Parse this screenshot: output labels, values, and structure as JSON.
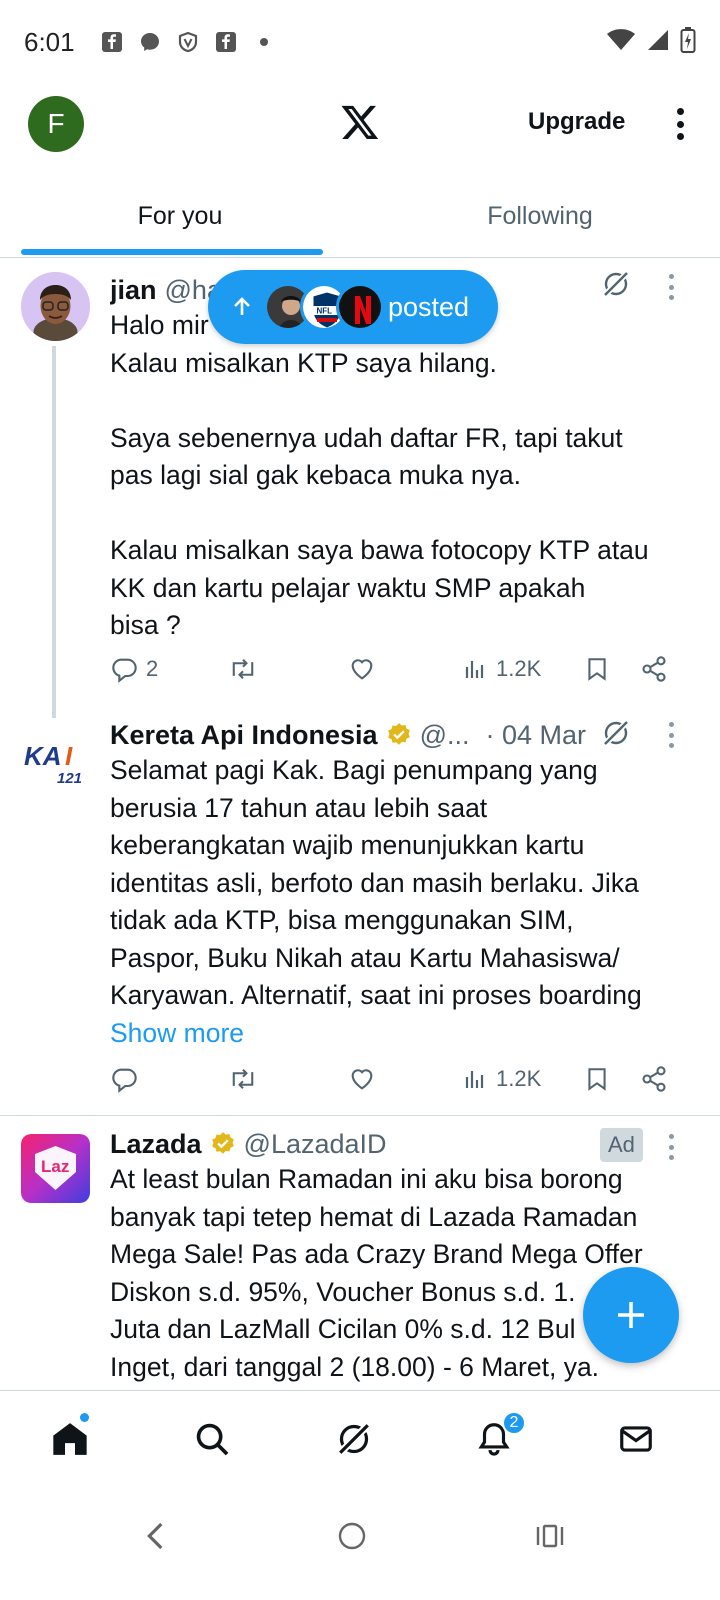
{
  "status_bar": {
    "time": "6:01"
  },
  "header": {
    "avatar_letter": "F",
    "upgrade_label": "Upgrade"
  },
  "tabs": [
    {
      "label": "For you",
      "active": true
    },
    {
      "label": "Following",
      "active": false
    }
  ],
  "posted_pill": {
    "label": "posted"
  },
  "posts": [
    {
      "name": "jian",
      "handle": "@hal",
      "text": "Halo mir\nKalau misalkan KTP saya hilang.\n\nSaya sebenernya udah daftar FR, tapi takut\npas lagi sial gak kebaca muka nya.\n\nKalau misalkan saya bawa fotocopy KTP atau\nKK dan kartu pelajar waktu SMP apakah\nbisa ?",
      "replies": "2",
      "views": "1.2K"
    },
    {
      "name": "Kereta Api Indonesia",
      "handle": "@...",
      "date": "· 04 Mar",
      "text": "Selamat pagi Kak. Bagi penumpang yang\nberusia 17 tahun atau lebih saat\nkeberangkatan wajib menunjukkan kartu\nidentitas asli, berfoto dan masih berlaku. Jika\ntidak ada KTP, bisa menggunakan SIM,\nPaspor, Buku Nikah atau Kartu Mahasiswa/\nKaryawan. Alternatif, saat ini proses boarding",
      "show_more": "Show more",
      "views": "1.2K",
      "avatar_text": "KAI",
      "avatar_sub": "121"
    },
    {
      "name": "Lazada",
      "handle": "@LazadaID",
      "ad_label": "Ad",
      "text": "At least bulan Ramadan ini aku bisa borong\nbanyak tapi tetep hemat di Lazada Ramadan\nMega Sale! Pas ada Crazy Brand Mega Offer\nDiskon s.d. 95%, Voucher Bonus s.d. 1.\nJuta dan LazMall Cicilan 0% s.d. 12 Bul\nInget, dari tanggal 2 (18.00) - 6 Maret, ya.",
      "avatar_text": "Laz"
    }
  ],
  "bottom_nav": {
    "notification_count": "2"
  },
  "colors": {
    "accent": "#1d9bf0",
    "text": "#0f1419",
    "muted": "#536471",
    "divider": "#cfd9de"
  }
}
